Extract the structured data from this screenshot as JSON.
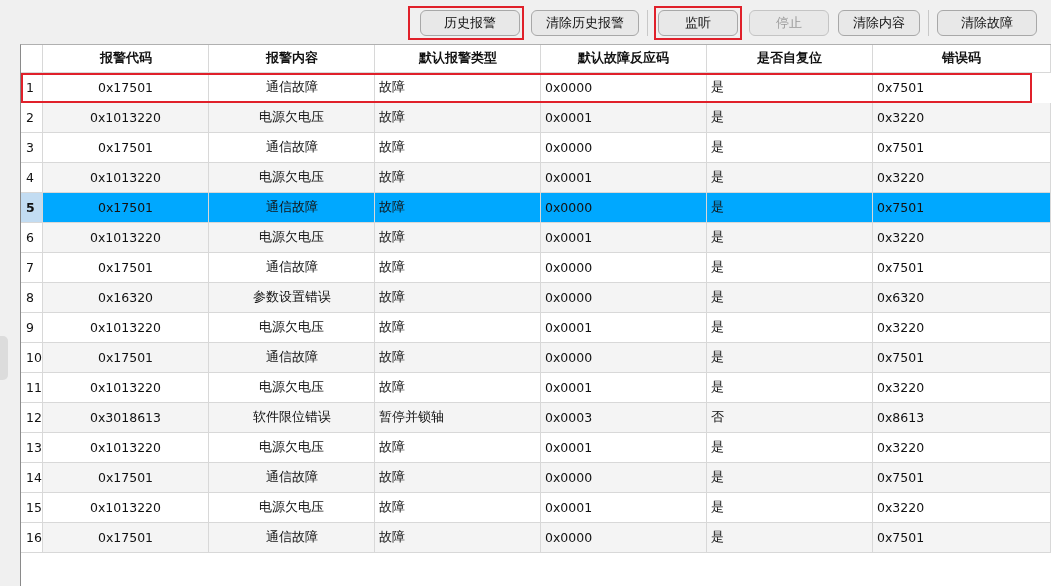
{
  "toolbar": {
    "buttons": [
      {
        "label": "历史报警",
        "disabled": false,
        "highlighted": true,
        "separator_after": false
      },
      {
        "label": "清除历史报警",
        "disabled": false,
        "highlighted": false,
        "separator_after": true
      },
      {
        "label": "监听",
        "disabled": false,
        "highlighted": true,
        "separator_after": false
      },
      {
        "label": "停止",
        "disabled": true,
        "highlighted": false,
        "separator_after": false
      },
      {
        "label": "清除内容",
        "disabled": false,
        "highlighted": false,
        "separator_after": true
      },
      {
        "label": "清除故障",
        "disabled": false,
        "highlighted": false,
        "separator_after": false
      }
    ]
  },
  "table": {
    "columns": [
      "报警代码",
      "报警内容",
      "默认报警类型",
      "默认故障反应码",
      "是否自复位",
      "错误码"
    ],
    "rows": [
      {
        "number": "1",
        "selected": false,
        "highlighted": true,
        "cells": [
          "0x17501",
          "通信故障",
          "故障",
          "0x0000",
          "是",
          "0x7501"
        ]
      },
      {
        "number": "2",
        "selected": false,
        "highlighted": false,
        "cells": [
          "0x1013220",
          "电源欠电压",
          "故障",
          "0x0001",
          "是",
          "0x3220"
        ]
      },
      {
        "number": "3",
        "selected": false,
        "highlighted": false,
        "cells": [
          "0x17501",
          "通信故障",
          "故障",
          "0x0000",
          "是",
          "0x7501"
        ]
      },
      {
        "number": "4",
        "selected": false,
        "highlighted": false,
        "cells": [
          "0x1013220",
          "电源欠电压",
          "故障",
          "0x0001",
          "是",
          "0x3220"
        ]
      },
      {
        "number": "5",
        "selected": true,
        "highlighted": false,
        "cells": [
          "0x17501",
          "通信故障",
          "故障",
          "0x0000",
          "是",
          "0x7501"
        ]
      },
      {
        "number": "6",
        "selected": false,
        "highlighted": false,
        "cells": [
          "0x1013220",
          "电源欠电压",
          "故障",
          "0x0001",
          "是",
          "0x3220"
        ]
      },
      {
        "number": "7",
        "selected": false,
        "highlighted": false,
        "cells": [
          "0x17501",
          "通信故障",
          "故障",
          "0x0000",
          "是",
          "0x7501"
        ]
      },
      {
        "number": "8",
        "selected": false,
        "highlighted": false,
        "cells": [
          "0x16320",
          "参数设置错误",
          "故障",
          "0x0000",
          "是",
          "0x6320"
        ]
      },
      {
        "number": "9",
        "selected": false,
        "highlighted": false,
        "cells": [
          "0x1013220",
          "电源欠电压",
          "故障",
          "0x0001",
          "是",
          "0x3220"
        ]
      },
      {
        "number": "10",
        "selected": false,
        "highlighted": false,
        "cells": [
          "0x17501",
          "通信故障",
          "故障",
          "0x0000",
          "是",
          "0x7501"
        ]
      },
      {
        "number": "11",
        "selected": false,
        "highlighted": false,
        "cells": [
          "0x1013220",
          "电源欠电压",
          "故障",
          "0x0001",
          "是",
          "0x3220"
        ]
      },
      {
        "number": "12",
        "selected": false,
        "highlighted": false,
        "cells": [
          "0x3018613",
          "软件限位错误",
          "暂停并锁轴",
          "0x0003",
          "否",
          "0x8613"
        ]
      },
      {
        "number": "13",
        "selected": false,
        "highlighted": false,
        "cells": [
          "0x1013220",
          "电源欠电压",
          "故障",
          "0x0001",
          "是",
          "0x3220"
        ]
      },
      {
        "number": "14",
        "selected": false,
        "highlighted": false,
        "cells": [
          "0x17501",
          "通信故障",
          "故障",
          "0x0000",
          "是",
          "0x7501"
        ]
      },
      {
        "number": "15",
        "selected": false,
        "highlighted": false,
        "cells": [
          "0x1013220",
          "电源欠电压",
          "故障",
          "0x0001",
          "是",
          "0x3220"
        ]
      },
      {
        "number": "16",
        "selected": false,
        "highlighted": false,
        "cells": [
          "0x17501",
          "通信故障",
          "故障",
          "0x0000",
          "是",
          "0x7501"
        ]
      }
    ]
  }
}
